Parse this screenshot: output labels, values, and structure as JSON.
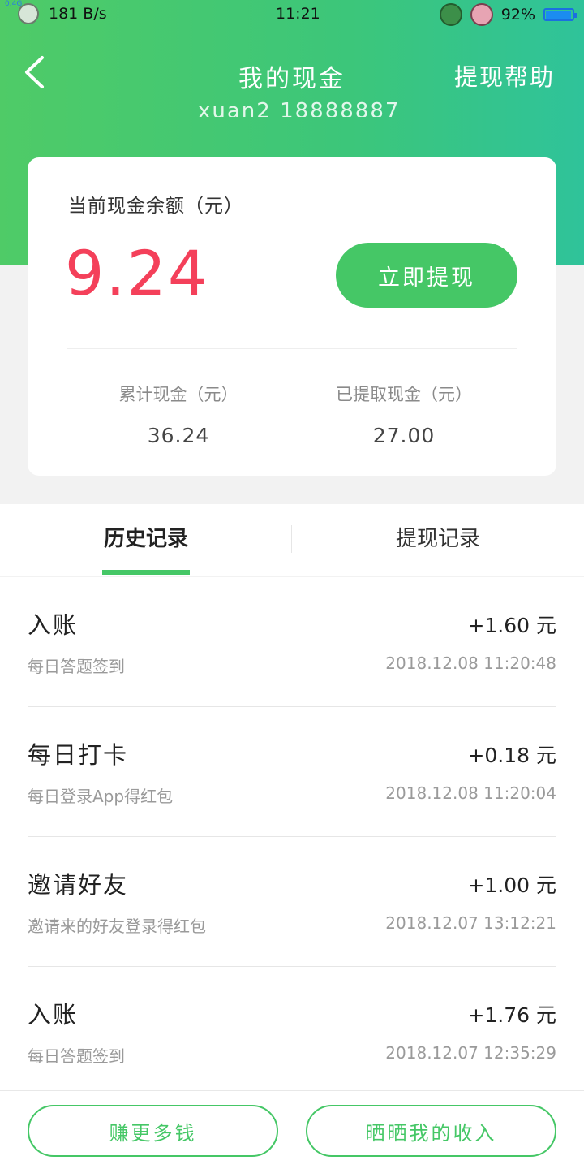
{
  "status_bar": {
    "network": "0.4G",
    "speed": "181 B/s",
    "time": "11:21",
    "battery": "92%"
  },
  "nav": {
    "title": "我的现金",
    "help": "提现帮助"
  },
  "account": {
    "masked_text": "xuan2 18888887"
  },
  "balance": {
    "label": "当前现金余额（元）",
    "amount": "9.24",
    "withdraw_button": "立即提现"
  },
  "stats": [
    {
      "label": "累计现金（元）",
      "value": "36.24"
    },
    {
      "label": "已提取现金（元）",
      "value": "27.00"
    }
  ],
  "tabs": [
    {
      "label": "历史记录",
      "active": true
    },
    {
      "label": "提现记录",
      "active": false
    }
  ],
  "records": [
    {
      "title": "入账",
      "amount": "+1.60 元",
      "subtitle": "每日答题签到",
      "time": "2018.12.08 11:20:48"
    },
    {
      "title": "每日打卡",
      "amount": "+0.18 元",
      "subtitle": "每日登录App得红包",
      "time": "2018.12.08 11:20:04"
    },
    {
      "title": "邀请好友",
      "amount": "+1.00 元",
      "subtitle": "邀请来的好友登录得红包",
      "time": "2018.12.07 13:12:21"
    },
    {
      "title": "入账",
      "amount": "+1.76 元",
      "subtitle": "每日答题签到",
      "time": "2018.12.07 12:35:29"
    }
  ],
  "bottom": {
    "earn_more": "赚更多钱",
    "share_income": "晒晒我的收入"
  },
  "colors": {
    "brand_green": "#45c766",
    "amount_red": "#f4405a"
  }
}
